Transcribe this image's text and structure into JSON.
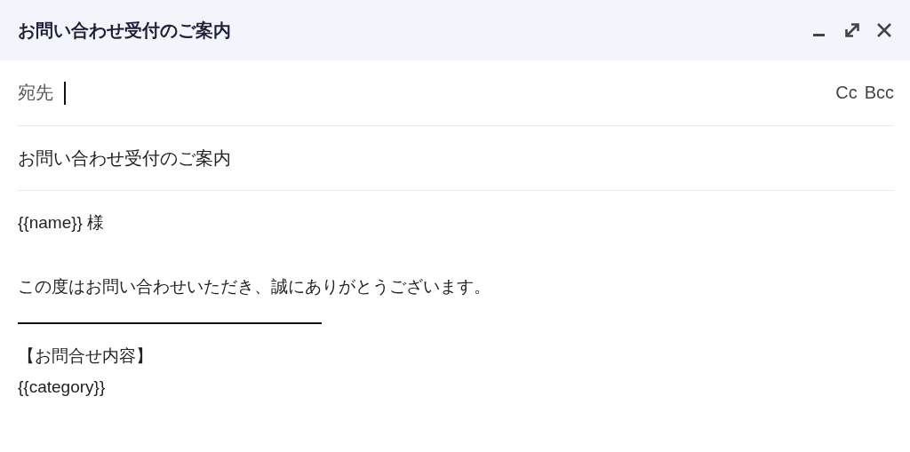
{
  "window": {
    "title": "お問い合わせ受付のご案内"
  },
  "recipients": {
    "label": "宛先",
    "focused": true
  },
  "recipient_links": [
    "Cc",
    "Bcc"
  ],
  "subject": {
    "value": "お問い合わせ受付のご案内"
  },
  "body": [
    {
      "kind": "text",
      "lines": [
        "{{name}} 様"
      ]
    },
    {
      "kind": "text",
      "lines": [
        "この度はお問い合わせいただき、誠にありがとうございます。"
      ]
    },
    {
      "kind": "rule"
    },
    {
      "kind": "text",
      "lines": [
        "【お問合せ内容】",
        "{{category}}"
      ]
    }
  ]
}
